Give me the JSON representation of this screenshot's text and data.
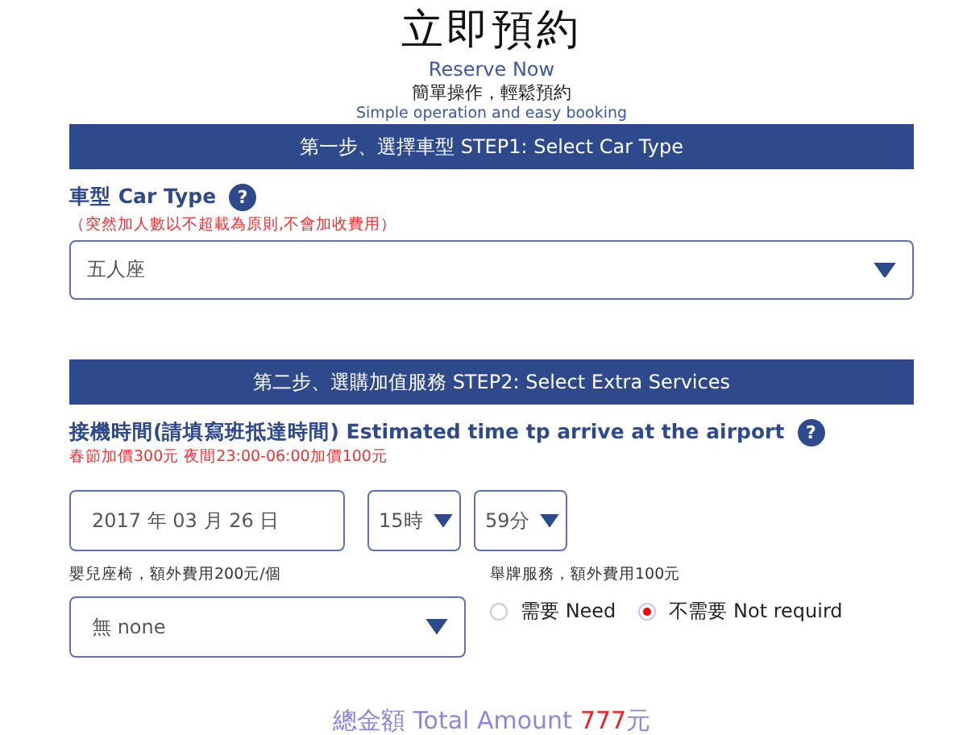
{
  "header": {
    "title": "立即預約",
    "subtitle": "Reserve Now",
    "tagline": "簡單操作，輕鬆預約",
    "tagline_en": "Simple operation and easy booking"
  },
  "step1": {
    "heading": "第一步、選擇車型 STEP1: Select Car Type",
    "label": "車型 Car Type",
    "help": "?",
    "note": "（突然加人數以不超載為原則,不會加收費用）",
    "select": {
      "value": "五人座"
    }
  },
  "step2": {
    "heading": "第二步、選購加值服務 STEP2: Select Extra Services",
    "label": "接機時間(請填寫班抵達時間) Estimated time tp arrive at the airport",
    "help": "?",
    "note": "春節加價300元 夜間23:00-06:00加價100元",
    "date": {
      "value": "2017 年 03 月 26 日"
    },
    "hour": {
      "value": "15時"
    },
    "minute": {
      "value": "59分"
    },
    "child_seat": {
      "label": "嬰兒座椅，額外費用200元/個",
      "value": "無 none"
    },
    "sign_service": {
      "label": "舉牌服務，額外費用100元",
      "options": [
        {
          "label": "需要 Need",
          "selected": false
        },
        {
          "label": "不需要 Not requird",
          "selected": true
        }
      ]
    }
  },
  "total": {
    "label": "總金額 Total Amount",
    "amount": "777",
    "unit": "元"
  }
}
